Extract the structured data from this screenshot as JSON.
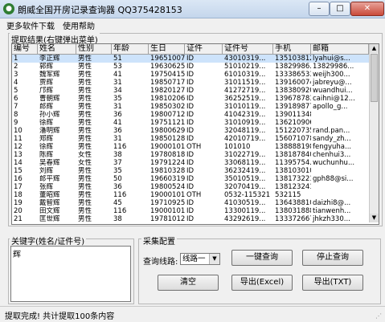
{
  "window": {
    "title": "朗威全国开房记录查询器 QQ375428153",
    "minimize_label": "–",
    "maximize_label": "□",
    "close_label": "✕"
  },
  "menu": [
    "更多软件下载",
    "使用帮助"
  ],
  "results": {
    "group_label": "提取结果(右键弹出菜单)",
    "columns": [
      "编号",
      "姓名",
      "性别",
      "年龄",
      "生日",
      "证件",
      "证件号",
      "手机",
      "邮箱"
    ],
    "rows": [
      [
        "1",
        "李正辉",
        "男性",
        "51",
        "19651007",
        "ID",
        "43010319...",
        "13510381278",
        "lyahui@s..."
      ],
      [
        "2",
        "郭辉",
        "男性",
        "53",
        "19630625",
        "ID",
        "51010219...",
        "13829986...",
        "13829986..."
      ],
      [
        "3",
        "魏军辉",
        "男性",
        "41",
        "19750415",
        "ID",
        "61010319...",
        "13338653385",
        "weijh300..."
      ],
      [
        "4",
        "贾辉",
        "男性",
        "31",
        "19850717",
        "ID",
        "31011519...",
        "13916007439",
        "jabreyu@..."
      ],
      [
        "5",
        "邝辉",
        "男性",
        "34",
        "19820127",
        "ID",
        "41272719...",
        "13838092073",
        "wuandhui..."
      ],
      [
        "6",
        "曹朝辉",
        "男性",
        "35",
        "19810206",
        "ID",
        "36252519...",
        "13967878376",
        "caihni@12..."
      ],
      [
        "7",
        "郎辉",
        "男性",
        "31",
        "19850302",
        "ID",
        "31010119...",
        "13918987742",
        "apollo_g..."
      ],
      [
        "8",
        "孙小辉",
        "男性",
        "36",
        "19800712",
        "ID",
        "41042319...",
        "13901134812",
        ""
      ],
      [
        "9",
        "徐辉",
        "男性",
        "41",
        "19751121",
        "ID",
        "31010919...",
        "13621090638",
        ""
      ],
      [
        "10",
        "潘明辉",
        "男性",
        "36",
        "19800629",
        "ID",
        "32048119...",
        "15122073566",
        "rand.pan..."
      ],
      [
        "11",
        "郑辉",
        "男性",
        "31",
        "19850128",
        "ID",
        "42010719...",
        "15607107868",
        "sandy_zh..."
      ],
      [
        "12",
        "徐辉",
        "男性",
        "116",
        "19000101",
        "OTH",
        "101010",
        "13888819814",
        "fengyuha..."
      ],
      [
        "13",
        "陈辉",
        "女性",
        "38",
        "19780818",
        "ID",
        "31022719...",
        "13818784037",
        "chenhui3..."
      ],
      [
        "14",
        "吴春辉",
        "女性",
        "37",
        "19791224",
        "ID",
        "33068119...",
        "11395754...",
        "wuchunhu..."
      ],
      [
        "15",
        "刘辉",
        "男性",
        "35",
        "19810328",
        "ID",
        "36232419...",
        "13810301028",
        ""
      ],
      [
        "16",
        "郎平辉",
        "男性",
        "50",
        "19660319",
        "ID",
        "35010519...",
        "13817322150",
        "gph88@si..."
      ],
      [
        "17",
        "张辉",
        "男性",
        "36",
        "19800524",
        "ID",
        "32070419...",
        "13812324123",
        ""
      ],
      [
        "18",
        "董昭辉",
        "男性",
        "116",
        "19000101",
        "OTH",
        "0532-115321",
        "532115",
        ""
      ],
      [
        "19",
        "戴智辉",
        "男性",
        "45",
        "19710925",
        "ID",
        "41030519...",
        "13643881000",
        "daizhi8@..."
      ],
      [
        "20",
        "田文辉",
        "男性",
        "116",
        "19000101",
        "ID",
        "13300119...",
        "13803188807",
        "tianwenh..."
      ],
      [
        "21",
        "匡世辉",
        "男性",
        "38",
        "19781012",
        "ID",
        "43292619...",
        "13337266799",
        "jhkzh330..."
      ]
    ],
    "selected_row": 0,
    "scroll_up": "▲",
    "scroll_down": "▼"
  },
  "keyword": {
    "group_label": "关键字(姓名/证件号)",
    "value": "辉"
  },
  "config": {
    "group_label": "采集配置",
    "route_label": "查询线路:",
    "route_value": "线路一",
    "dropdown_arrow": "▼",
    "buttons": {
      "query": "一键查询",
      "stop": "停止查询",
      "clear": "清空",
      "export_excel": "导出(Excel)",
      "export_txt": "导出(TXT)"
    }
  },
  "status": {
    "text": "提取完成! 共计提取100条内容"
  }
}
